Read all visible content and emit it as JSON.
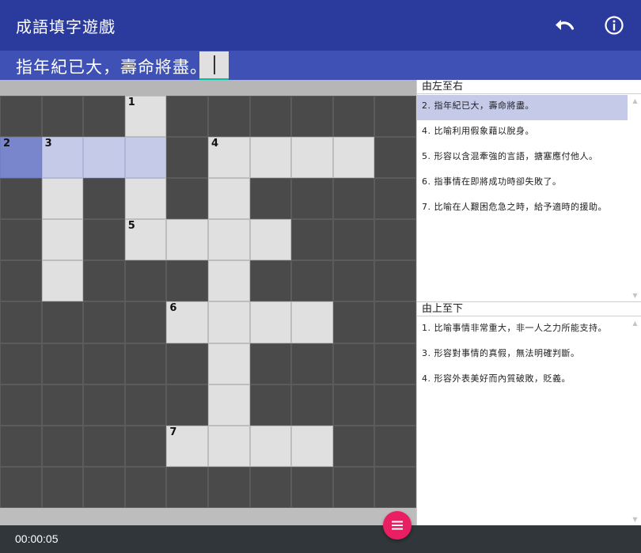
{
  "header": {
    "title": "成語填字遊戲",
    "undo_icon": "undo-icon",
    "info_icon": "info-icon"
  },
  "current_clue": {
    "text": "指年紀已大，壽命將盡。",
    "answer_value": ""
  },
  "board": {
    "rows": 10,
    "cols": 10,
    "layout": [
      "###O######",
      "WWWW#OOOO#",
      "#O#O#O####",
      "#O#OOOO###",
      "#O###O####",
      "####OOOO##",
      "#####O####",
      "#####O####",
      "####OOOO##",
      "##########"
    ],
    "numbers": [
      {
        "row": 0,
        "col": 3,
        "n": "1"
      },
      {
        "row": 1,
        "col": 0,
        "n": "2"
      },
      {
        "row": 1,
        "col": 1,
        "n": "3"
      },
      {
        "row": 1,
        "col": 5,
        "n": "4"
      },
      {
        "row": 3,
        "col": 3,
        "n": "5"
      },
      {
        "row": 5,
        "col": 4,
        "n": "6"
      },
      {
        "row": 8,
        "col": 4,
        "n": "7"
      }
    ],
    "active_cell": {
      "row": 1,
      "col": 0
    }
  },
  "across": {
    "heading": "由左至右",
    "clues": [
      {
        "label": "2. 指年紀已大，壽命將盡。",
        "selected": true
      },
      {
        "label": "4. 比喻利用假象藉以脫身。",
        "selected": false
      },
      {
        "label": "5. 形容以含混牽強的言語，搪塞應付他人。",
        "selected": false
      },
      {
        "label": "6. 指事情在即將成功時卻失敗了。",
        "selected": false
      },
      {
        "label": "7. 比喻在人艱困危急之時，給予適時的援助。",
        "selected": false
      }
    ]
  },
  "down": {
    "heading": "由上至下",
    "clues": [
      {
        "label": "1. 比喻事情非常重大，非一人之力所能支持。",
        "selected": false
      },
      {
        "label": "3. 形容對事情的真假，無法明確判斷。",
        "selected": false
      },
      {
        "label": "4. 形容外表美好而內質破敗，貶義。",
        "selected": false
      }
    ]
  },
  "footer": {
    "timer": "00:00:05",
    "menu_icon": "menu-icon"
  },
  "colors": {
    "header": "#2a3a9d",
    "banner": "#3f51b5",
    "active_cell": "#7986cb",
    "word_cell": "#c5cae9",
    "open_cell": "#e0e0e0",
    "block_cell": "#4a4a4a",
    "fab": "#e91e63",
    "footer": "#303639"
  }
}
